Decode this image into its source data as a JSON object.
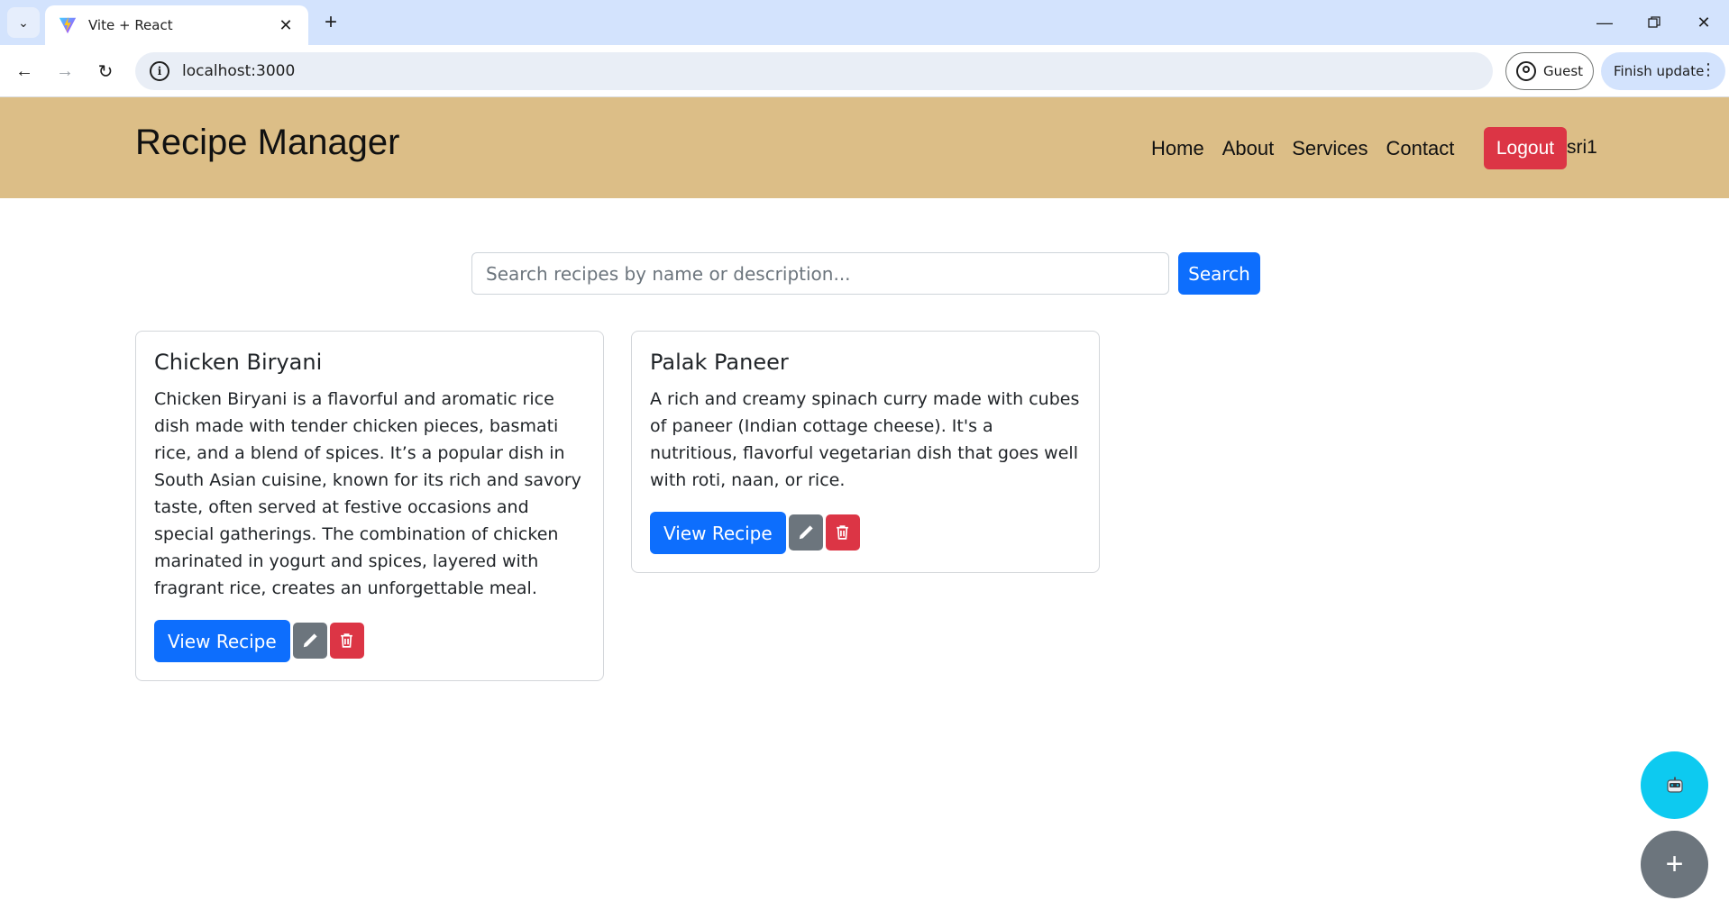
{
  "browser": {
    "tab_title": "Vite + React",
    "url": "localhost:3000",
    "profile_label": "Guest",
    "update_label": "Finish update"
  },
  "navbar": {
    "brand": "Recipe Manager",
    "links": [
      "Home",
      "About",
      "Services",
      "Contact"
    ],
    "logout_label": "Logout",
    "username": "sri1",
    "background_color": "#dcbe87"
  },
  "search": {
    "placeholder": "Search recipes by name or description...",
    "value": "",
    "button_label": "Search"
  },
  "recipes": [
    {
      "title": "Chicken Biryani",
      "description": "Chicken Biryani is a flavorful and aromatic rice dish made with tender chicken pieces, basmati rice, and a blend of spices. It’s a popular dish in South Asian cuisine, known for its rich and savory taste, often served at festive occasions and special gatherings. The combination of chicken marinated in yogurt and spices, layered with fragrant rice, creates an unforgettable meal.",
      "view_label": "View Recipe"
    },
    {
      "title": "Palak Paneer",
      "description": "A rich and creamy spinach curry made with cubes of paneer (Indian cottage cheese). It's a nutritious, flavorful vegetarian dish that goes well with roti, naan, or rice.",
      "view_label": "View Recipe"
    }
  ],
  "fab": {
    "add_symbol": "+"
  },
  "colors": {
    "primary": "#0d6efd",
    "danger": "#dc3545",
    "secondary": "#6c757d",
    "info": "#0dcaf0"
  }
}
